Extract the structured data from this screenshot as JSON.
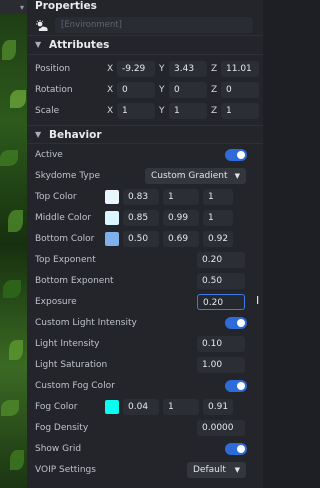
{
  "panel_title": "Properties",
  "environment": {
    "placeholder": "[Environment]"
  },
  "attributes": {
    "title": "Attributes",
    "rows": [
      {
        "label": "Position",
        "x": "-9.29",
        "y": "3.43",
        "z": "11.01"
      },
      {
        "label": "Rotation",
        "x": "0",
        "y": "0",
        "z": "0"
      },
      {
        "label": "Scale",
        "x": "1",
        "y": "1",
        "z": "1"
      }
    ],
    "axis": {
      "x": "X",
      "y": "Y",
      "z": "Z"
    }
  },
  "behavior": {
    "title": "Behavior",
    "active_label": "Active",
    "skydome": {
      "label": "Skydome Type",
      "value": "Custom Gradient"
    },
    "top_color": {
      "label": "Top Color",
      "swatch": "#e9f6fb",
      "r": "0.83",
      "g": "1",
      "b": "1"
    },
    "middle_color": {
      "label": "Middle Color",
      "swatch": "#daf7ff",
      "r": "0.85",
      "g": "0.99",
      "b": "1"
    },
    "bottom_color": {
      "label": "Bottom Color",
      "swatch": "#80b0eb",
      "r": "0.50",
      "g": "0.69",
      "b": "0.92"
    },
    "top_exponent": {
      "label": "Top Exponent",
      "value": "0.20"
    },
    "bottom_exponent": {
      "label": "Bottom Exponent",
      "value": "0.50"
    },
    "exposure": {
      "label": "Exposure",
      "value": "0.20"
    },
    "custom_light_intensity_label": "Custom Light Intensity",
    "light_intensity": {
      "label": "Light Intensity",
      "value": "0.10"
    },
    "light_saturation": {
      "label": "Light Saturation",
      "value": "1.00"
    },
    "custom_fog_color_label": "Custom Fog Color",
    "fog_color": {
      "label": "Fog Color",
      "swatch": "#0afff0",
      "r": "0.04",
      "g": "1",
      "b": "0.91"
    },
    "fog_density": {
      "label": "Fog Density",
      "value": "0.0000"
    },
    "show_grid_label": "Show Grid",
    "voip": {
      "label": "VOIP Settings",
      "value": "Default"
    }
  },
  "colors": {
    "accent": "#2f6bd8",
    "panel_bg": "#23252b",
    "field_bg": "#2c2e35"
  }
}
